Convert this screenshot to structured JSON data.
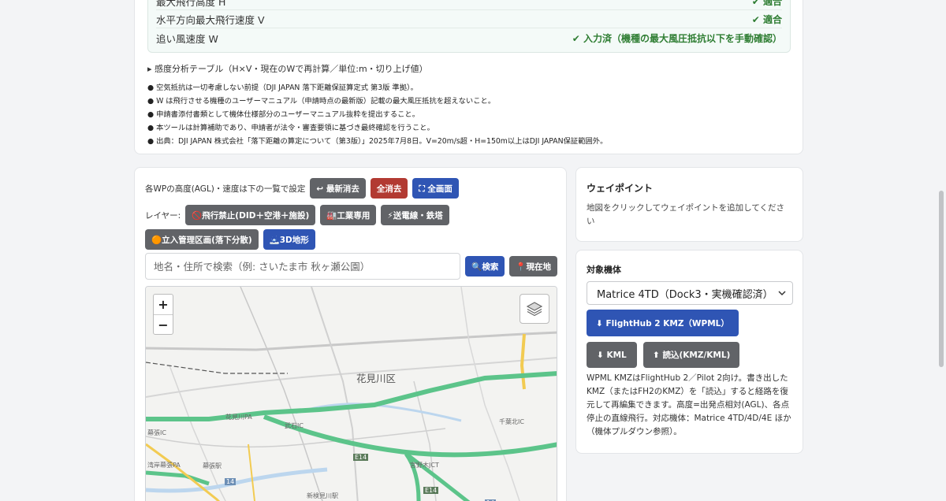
{
  "results": [
    {
      "label": "最大飛行高度 H",
      "status": "✔ 適合"
    },
    {
      "label": "水平方向最大飛行速度 V",
      "status": "✔ 適合"
    },
    {
      "label": "追い風速度 W",
      "status": "✔ 入力済（機種の最大風圧抵抗以下を手動確認）"
    }
  ],
  "sensitivity_toggle": "▸ 感度分析テーブル（H×V・現在のWで再計算／単位:m・切り上げ値）",
  "notes": [
    "● 空気抵抗は一切考慮しない前提（DJI JAPAN 落下距離保証算定式 第3版 準拠）。",
    "● W は飛行させる機種のユーザーマニュアル（申請時点の最新版）記載の最大風圧抵抗を超えないこと。",
    "● 申請書添付書類として機体仕様部分のユーザーマニュアル抜粋を提出すること。",
    "● 本ツールは計算補助であり、申請者が法令・審査要領に基づき最終確認を行うこと。",
    "● 出典：DJI JAPAN 株式会社「落下距離の算定について（第3版）」2025年7月8日。V=20m/s超・H=150m以上はDJI JAPAN保証範囲外。"
  ],
  "map_panel": {
    "agl_label": "各WPの高度(AGL)・速度は下の一覧で設定",
    "undo_button": "↩ 最新消去",
    "clear_all_button": "全消去",
    "fullscreen_button": "⛶ 全画面",
    "layer_label": "レイヤー:",
    "layers": [
      "🚫飛行禁止(DID＋空港＋施設)",
      "🏭工業専用",
      "⚡送電線・鉄塔"
    ],
    "layers2": [
      "🟠立入管理区画(落下分散)",
      "🗻3D地形"
    ],
    "search_placeholder": "地名・住所で検索（例: さいたま市 秋ヶ瀬公園）",
    "search_button": "🔍検索",
    "locate_button": "📍現在地",
    "zoom_in": "+",
    "zoom_out": "−",
    "map_labels": {
      "ward": "花見川区",
      "l1": "花見川PA",
      "l2": "武石IC",
      "l3": "幕張IC",
      "l4": "湾岸幕張PA",
      "l5": "幕張駅",
      "l6": "宮野木JCT",
      "l7": "千葉北IC",
      "l8": "新検見川駅",
      "r1": "E14",
      "r2": "14",
      "r3": "E14",
      "r4": "14"
    }
  },
  "waypoint": {
    "title": "ウェイポイント",
    "hint": "地図をクリックしてウェイポイントを追加してください"
  },
  "aircraft": {
    "title": "対象機体",
    "selected": "Matrice 4TD（Dock3・実機確認済）",
    "kmz_button": "⬇ FlightHub 2 KMZ（WPML）",
    "kml_button": "⬇ KML",
    "import_button": "⬆ 読込(KMZ/KML)",
    "description": "WPML KMZはFlightHub 2／Pilot 2向け。書き出したKMZ（またはFH2のKMZ）を「読込」すると経路を復元して再編集できます。高度=出発点相対(AGL)、各点停止の直線飛行。対応機体：Matrice 4TD/4D/4E ほか（機体プルダウン参照）。"
  },
  "colors": {
    "ok": "#2e7d32",
    "gray_button": "#616367",
    "red_button": "#b23a32",
    "blue_button": "#2f55b4",
    "road_green": "#5cc48a"
  }
}
